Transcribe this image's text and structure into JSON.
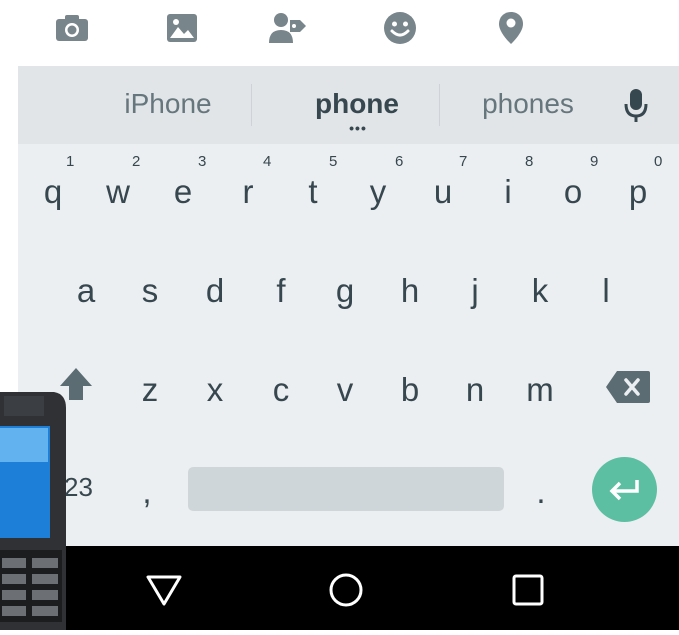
{
  "toolbar": {
    "icons": [
      "camera-icon",
      "image-icon",
      "person-tag-icon",
      "smiley-icon",
      "location-pin-icon"
    ]
  },
  "suggestions": {
    "left": "iPhone",
    "center": "phone",
    "center_more": "•••",
    "right": "phones"
  },
  "keyboard": {
    "row1": [
      "q",
      "w",
      "e",
      "r",
      "t",
      "y",
      "u",
      "i",
      "o",
      "p"
    ],
    "row1_hints": [
      "1",
      "2",
      "3",
      "4",
      "5",
      "6",
      "7",
      "8",
      "9",
      "0"
    ],
    "row2": [
      "a",
      "s",
      "d",
      "f",
      "g",
      "h",
      "j",
      "k",
      "l"
    ],
    "row3": [
      "z",
      "x",
      "c",
      "v",
      "b",
      "n",
      "m"
    ],
    "symbols_label": "23",
    "comma": ",",
    "period": "."
  },
  "colors": {
    "keyboard_bg": "#eceff1",
    "suggest_bg": "#e1e5e7",
    "key_text": "#37474f",
    "enter_accent": "#5cbfa1",
    "nav_bg": "#000000"
  }
}
